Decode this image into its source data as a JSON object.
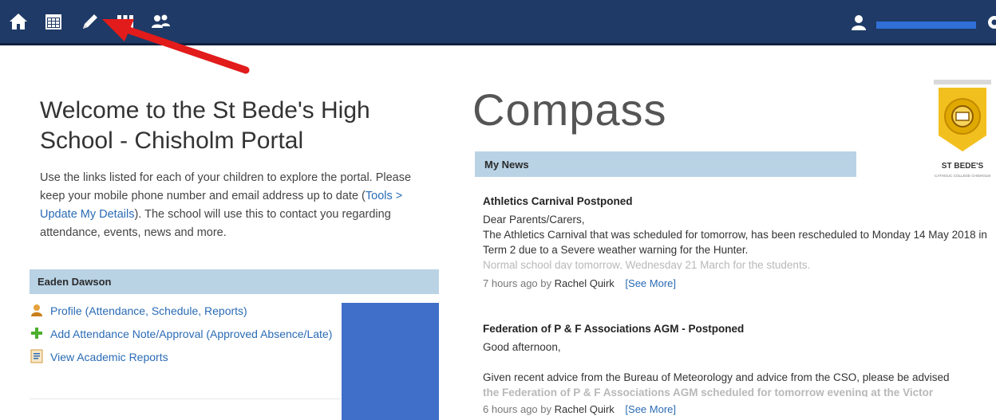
{
  "header": {
    "icons": [
      "home-icon",
      "calendar-icon",
      "pencil-icon",
      "columns-icon",
      "people-icon",
      "user-icon",
      "gear-icon"
    ]
  },
  "welcome": {
    "title": "Welcome to the St Bede's High School - Chisholm Portal",
    "intro_part1": "Use the links listed for each of your children to explore the portal. Please keep your mobile phone number and email address up to date (",
    "intro_link": "Tools > Update My Details",
    "intro_part2": "). The school will use this to contact you regarding attendance, events, news and more."
  },
  "child": {
    "name": "Eaden Dawson",
    "links": [
      {
        "label": "Profile (Attendance, Schedule, Reports)",
        "icon": "profile-icon"
      },
      {
        "label": "Add Attendance Note/Approval (Approved Absence/Late)",
        "icon": "plus-icon"
      },
      {
        "label": "View Academic Reports",
        "icon": "report-icon"
      }
    ]
  },
  "brand": {
    "title": "Compass",
    "logo_text": "ST BEDE'S",
    "logo_sub": "CATHOLIC COLLEGE CHISHOLM"
  },
  "news": {
    "header": "My News",
    "items": [
      {
        "title": "Athletics Carnival Postponed",
        "body1": "Dear Parents/Carers,",
        "body2": "The Athletics Carnival that was scheduled for tomorrow, has been rescheduled to Monday 14 May 2018 in Term 2 due to a Severe weather warning for the Hunter.",
        "fade": "Normal school day tomorrow, Wednesday 21 March for the students.",
        "time": "7 hours ago by",
        "author": "Rachel Quirk",
        "more": "[See More]"
      },
      {
        "title": "Federation of P & F Associations AGM - Postponed",
        "body1": "Good afternoon,",
        "body2": "Given recent advice from the Bureau of Meteorology and advice from the CSO, please be advised",
        "fade": "the Federation of P & F Associations AGM scheduled for tomorrow evening at the Victor",
        "time": "6 hours ago by",
        "author": "Rachel Quirk",
        "more": "[See More]"
      }
    ]
  },
  "colors": {
    "topbar": "#1f3a66",
    "accent_blue": "#2f6fd6",
    "section_header": "#b9d3e5",
    "link": "#2a6bb5",
    "arrow": "#e21b1b",
    "logo_gold": "#f2c01e"
  }
}
